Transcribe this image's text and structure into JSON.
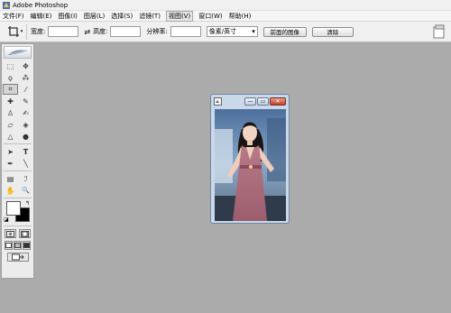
{
  "app": {
    "title": "Adobe Photoshop",
    "icon": "photoshop-app-icon"
  },
  "menu": [
    {
      "label": "文件(F)"
    },
    {
      "label": "编辑(E)"
    },
    {
      "label": "图像(I)"
    },
    {
      "label": "图层(L)"
    },
    {
      "label": "选择(S)"
    },
    {
      "label": "滤镜(T)"
    },
    {
      "label": "视图(V)",
      "active": true
    },
    {
      "label": "窗口(W)"
    },
    {
      "label": "帮助(H)"
    }
  ],
  "options": {
    "tool_icon": "crop-tool-icon",
    "width_label": "宽度:",
    "width_value": "",
    "swap_icon": "swap-icon",
    "height_label": "高度:",
    "height_value": "",
    "resolution_label": "分辨率:",
    "resolution_value": "",
    "unit_select": "像素/英寸",
    "front_image_button": "前面的图像",
    "clear_button": "清除",
    "palette_icon": "palette-well-icon"
  },
  "toolbox": {
    "tools": [
      {
        "name": "marquee-tool-icon",
        "glyph": "⬚"
      },
      {
        "name": "move-tool-icon",
        "glyph": "✥"
      },
      {
        "name": "lasso-tool-icon",
        "glyph": "ϙ"
      },
      {
        "name": "magic-wand-tool-icon",
        "glyph": "⁂"
      },
      {
        "name": "crop-tool-icon",
        "glyph": "⌗",
        "selected": true
      },
      {
        "name": "slice-tool-icon",
        "glyph": "⁄"
      },
      {
        "name": "healing-brush-tool-icon",
        "glyph": "✚"
      },
      {
        "name": "brush-tool-icon",
        "glyph": "✎"
      },
      {
        "name": "clone-stamp-tool-icon",
        "glyph": "♙"
      },
      {
        "name": "history-brush-tool-icon",
        "glyph": "✍"
      },
      {
        "name": "eraser-tool-icon",
        "glyph": "▱"
      },
      {
        "name": "paint-bucket-tool-icon",
        "glyph": "◈"
      },
      {
        "name": "blur-tool-icon",
        "glyph": "△"
      },
      {
        "name": "dodge-tool-icon",
        "glyph": "●"
      },
      {
        "name": "path-selection-tool-icon",
        "glyph": "➤"
      },
      {
        "name": "type-tool-icon",
        "glyph": "T"
      },
      {
        "name": "pen-tool-icon",
        "glyph": "✒"
      },
      {
        "name": "line-tool-icon",
        "glyph": "╲"
      },
      {
        "name": "notes-tool-icon",
        "glyph": "▤"
      },
      {
        "name": "eyedropper-tool-icon",
        "glyph": "ℐ"
      },
      {
        "name": "hand-tool-icon",
        "glyph": "✋"
      },
      {
        "name": "zoom-tool-icon",
        "glyph": "🔍"
      }
    ],
    "foreground_color": "#ffffff",
    "background_color": "#000000"
  },
  "document": {
    "title": "",
    "minimize": "—",
    "maximize": "▭",
    "close": "✕"
  }
}
